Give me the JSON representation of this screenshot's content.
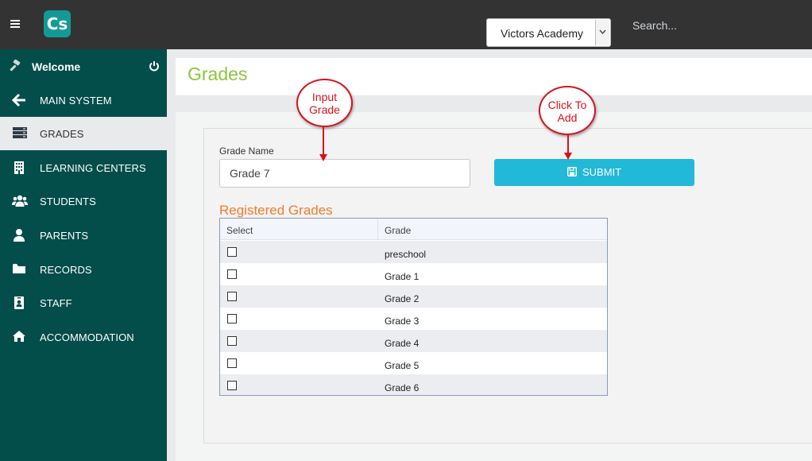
{
  "topbar": {
    "logo_text": "Cs",
    "school_selected": "Victors Academy",
    "search_placeholder": "Search..."
  },
  "sidebar": {
    "welcome_label": "Welcome",
    "items": [
      {
        "label": "MAIN SYSTEM",
        "icon": "arrow-left-icon"
      },
      {
        "label": "GRADES",
        "icon": "server-icon",
        "active": true
      },
      {
        "label": "LEARNING CENTERS",
        "icon": "building-icon"
      },
      {
        "label": "STUDENTS",
        "icon": "users-icon"
      },
      {
        "label": "PARENTS",
        "icon": "user-icon"
      },
      {
        "label": "RECORDS",
        "icon": "folder-icon"
      },
      {
        "label": "STAFF",
        "icon": "id-badge-icon"
      },
      {
        "label": "ACCOMMODATION",
        "icon": "home-icon"
      }
    ]
  },
  "page": {
    "title": "Grades"
  },
  "form": {
    "grade_name_label": "Grade Name",
    "grade_name_value": "Grade 7",
    "submit_label": "SUBMIT"
  },
  "registered": {
    "title": "Registered Grades",
    "columns": [
      "Select",
      "Grade"
    ],
    "rows": [
      "preschool",
      "Grade 1",
      "Grade 2",
      "Grade 3",
      "Grade 4",
      "Grade 5",
      "Grade 6"
    ]
  },
  "annotations": {
    "input_line1": "Input",
    "input_line2": "Grade",
    "click_line1": "Click To",
    "click_line2": "Add"
  },
  "colors": {
    "topbar": "#333333",
    "sidebar": "#034d4a",
    "logo": "#139a96",
    "title": "#8cc63f",
    "submit": "#22b8d8",
    "registered_title": "#ef7d2c",
    "annotation": "#d9121a"
  }
}
